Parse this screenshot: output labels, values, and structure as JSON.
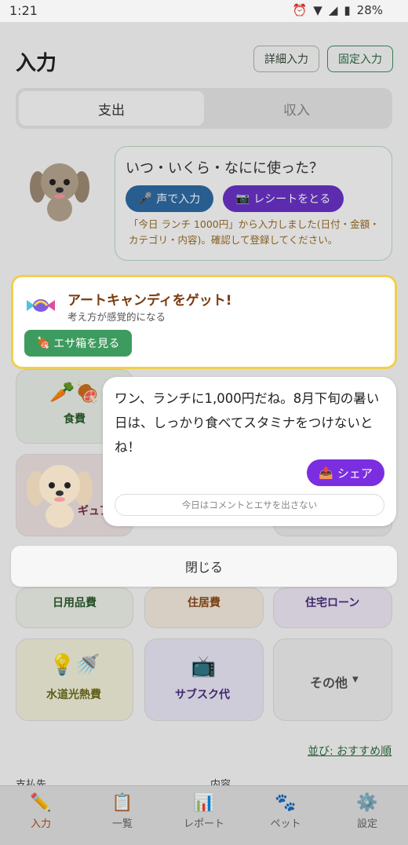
{
  "status_bar": {
    "time": "1:21",
    "battery": "28%"
  },
  "header": {
    "title": "入力",
    "detail_button": "詳細入力",
    "fixed_button": "固定入力"
  },
  "tabs": {
    "expense": "支出",
    "income": "収入"
  },
  "assistant": {
    "question": "いつ・いくら・なにに使った？",
    "voice_button": "声で入力",
    "receipt_button": "レシートをとる",
    "note": "「今日 ランチ 1000円」から入力しました(日付・金額・カテゴリ・内容)。確認して登録してください。"
  },
  "categories": {
    "food": "食費",
    "hobby_partial": "ギュア",
    "daily_goods": "日用品費",
    "housing": "住居費",
    "mortgage": "住宅ローン",
    "utilities": "水道光熱費",
    "subscription": "サブスク代",
    "other": "その他"
  },
  "toast": {
    "title": "アートキャンディをゲット!",
    "subtitle": "考え方が感覚的になる",
    "button": "エサ箱を見る"
  },
  "comment": {
    "text": "ワン、ランチに1,000円だね。8月下旬の暑い日は、しっかり食べてスタミナをつけないとね！",
    "share_button": "シェア",
    "silent_button": "今日はコメントとエサを出さない"
  },
  "close_button": "閉じる",
  "sort_link": "並び: おすすめ順",
  "fields": {
    "payee": "支払先",
    "content": "内容"
  },
  "nav": [
    {
      "label": "入力",
      "icon": "pencil-icon"
    },
    {
      "label": "一覧",
      "icon": "clipboard-icon"
    },
    {
      "label": "レポート",
      "icon": "bar-chart-icon"
    },
    {
      "label": "ペット",
      "icon": "paw-icon"
    },
    {
      "label": "設定",
      "icon": "gear-icon"
    }
  ],
  "colors": {
    "accent_green": "#3e9b5f",
    "accent_purple": "#7b2ee0",
    "voice_blue": "#2e6aa4",
    "toast_border": "#f0cf4f"
  }
}
